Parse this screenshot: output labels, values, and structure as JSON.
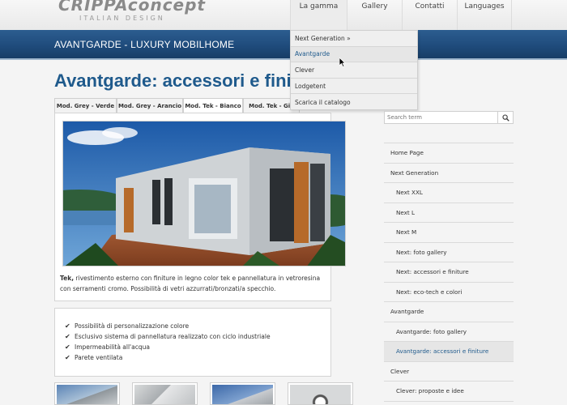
{
  "header": {
    "logo_brand": "CRIPPAconcept",
    "logo_tagline": "ITALIAN DESIGN",
    "nav": [
      "La gamma",
      "Gallery",
      "Contatti",
      "Languages"
    ]
  },
  "dropdown": {
    "items": [
      "Next Generation »",
      "Avantgarde",
      "Clever",
      "Lodgetent",
      "Scarica il catalogo"
    ]
  },
  "banner": {
    "title": "AVANTGARDE - LUXURY MOBILHOME"
  },
  "page": {
    "title": "Avantgarde: accessori e finiture",
    "tabs": [
      "Mod. Grey - Verde",
      "Mod. Grey - Arancio",
      "Mod. Tek - Bianco",
      "Mod. Tek - Gia"
    ],
    "description_bold": "Tek,",
    "description_rest": " rivestimento esterno con finiture in legno color tek e pannellatura in vetroresina con serramenti cromo. Possibilità di vetri azzurrati/bronzati/a specchio.",
    "features": [
      "Possibilità di personalizzazione colore",
      "Esclusivo sistema di pannellatura realizzato con ciclo industriale",
      "Impermeabilità all'acqua",
      "Parete ventilata"
    ]
  },
  "sidebar": {
    "search_placeholder": "Search term",
    "items": [
      "Home Page",
      "Next Generation",
      "Next XXL",
      "Next L",
      "Next M",
      "Next: foto gallery",
      "Next: accessori e finiture",
      "Next: eco-tech e colori",
      "Avantgarde",
      "Avantgarde: foto gallery",
      "Avantgarde: accessori e finiture",
      "Clever",
      "Clever: proposte e idee"
    ]
  },
  "colors": {
    "accent_blue": "#1f5a8c",
    "banner_blue": "#1e4a7a"
  }
}
